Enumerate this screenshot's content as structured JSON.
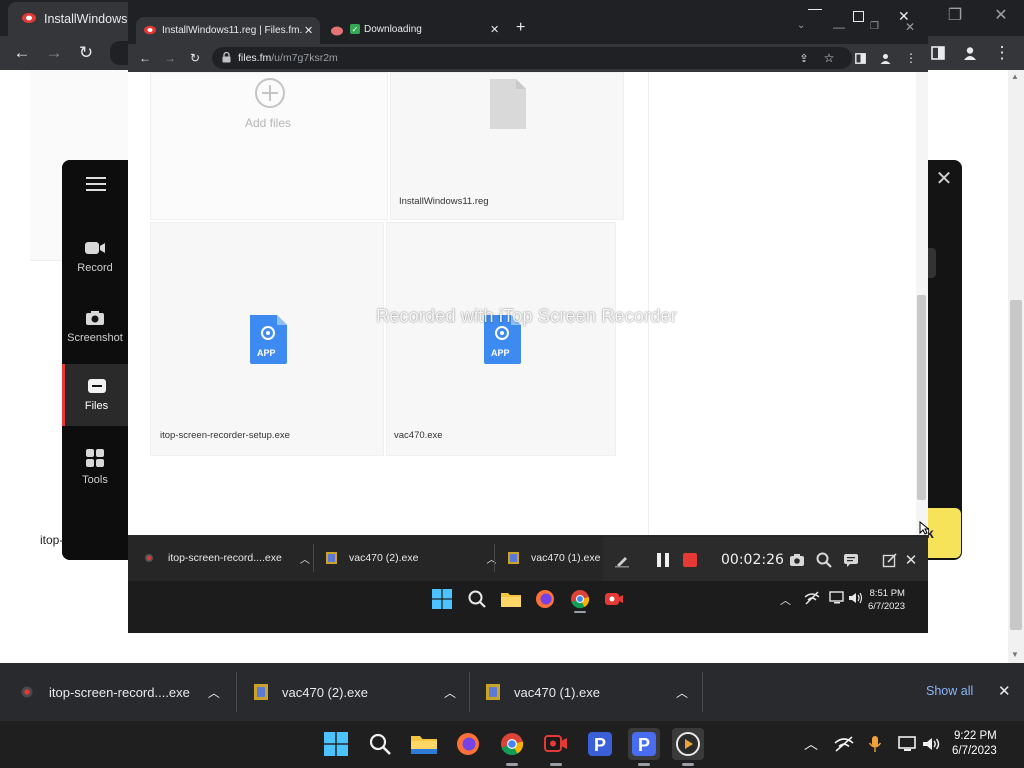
{
  "outer_browser": {
    "tab_title": "InstallWindows1",
    "toolbar_icons": [
      "back-icon",
      "forward-icon",
      "reload-icon",
      "sidepanel-icon",
      "profile-icon",
      "menu-icon"
    ]
  },
  "itop_app": {
    "sidebar": [
      {
        "label": "Record",
        "icon": "record-icon"
      },
      {
        "label": "Screenshot",
        "icon": "camera-icon"
      },
      {
        "label": "Files",
        "icon": "files-icon",
        "active": true
      },
      {
        "label": "Tools",
        "icon": "tools-icon"
      }
    ],
    "partial_label": "itop-",
    "yellow_button_partial": "k"
  },
  "inner_browser": {
    "tabs": [
      {
        "title": "InstallWindows11.reg | Files.fm.",
        "active": true
      },
      {
        "title": "Downloading",
        "active": false
      }
    ],
    "url_host": "files.fm",
    "url_path": "/u/m7g7ksr2m"
  },
  "files": {
    "add_files_label": "Add files",
    "items": [
      {
        "name": "InstallWindows11.reg",
        "type": "generic"
      },
      {
        "name": "itop-screen-recorder-setup.exe",
        "type": "app",
        "badge": "APP"
      },
      {
        "name": "vac470.exe",
        "type": "app",
        "badge": "APP"
      }
    ]
  },
  "watermark": "Recorded with iTop Screen Recorder",
  "inner_downloads": [
    {
      "name": "itop-screen-record....exe"
    },
    {
      "name": "vac470 (2).exe"
    },
    {
      "name": "vac470 (1).exe"
    }
  ],
  "recorder": {
    "elapsed": "00:02:26"
  },
  "inner_taskbar": {
    "time": "8:51 PM",
    "date": "6/7/2023"
  },
  "outer_downloads": [
    {
      "name": "itop-screen-record....exe"
    },
    {
      "name": "vac470 (2).exe"
    },
    {
      "name": "vac470 (1).exe"
    }
  ],
  "show_all_label": "Show all",
  "outer_taskbar": {
    "time": "9:22 PM",
    "date": "6/7/2023"
  },
  "colors": {
    "accent_red": "#e53935",
    "link_blue": "#8ab4f8",
    "app_blue": "#3d8bf0",
    "highlight_yellow": "#f7e35a"
  }
}
